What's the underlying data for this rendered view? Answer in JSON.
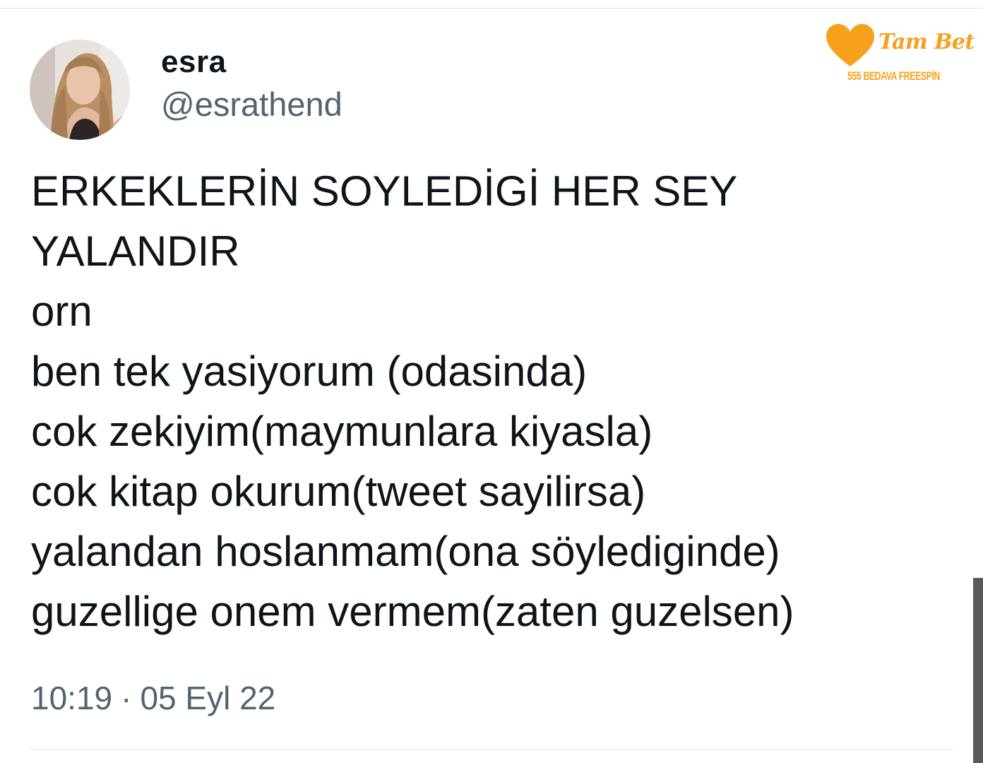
{
  "author": {
    "display_name": "esra",
    "handle": "@esrathend"
  },
  "tweet": {
    "lines": [
      "ERKEKLERİN SOYLEDİGİ HER SEY",
      "YALANDIR",
      "orn",
      "ben tek yasiyorum (odasinda)",
      "cok zekiyim(maymunlara kiyasla)",
      "cok kitap okurum(tweet sayilirsa)",
      "yalandan hoslanmam(ona söylediginde)",
      "guzellige onem vermem(zaten guzelsen)"
    ],
    "time": "10:19",
    "separator": "·",
    "date": "05 Eyl 22"
  },
  "watermark": {
    "brand": "Tam Bet",
    "tagline": "555 BEDAVA FREESPİN",
    "color": "#f7a01c"
  },
  "colors": {
    "text": "#0f1419",
    "secondary": "#536471"
  }
}
